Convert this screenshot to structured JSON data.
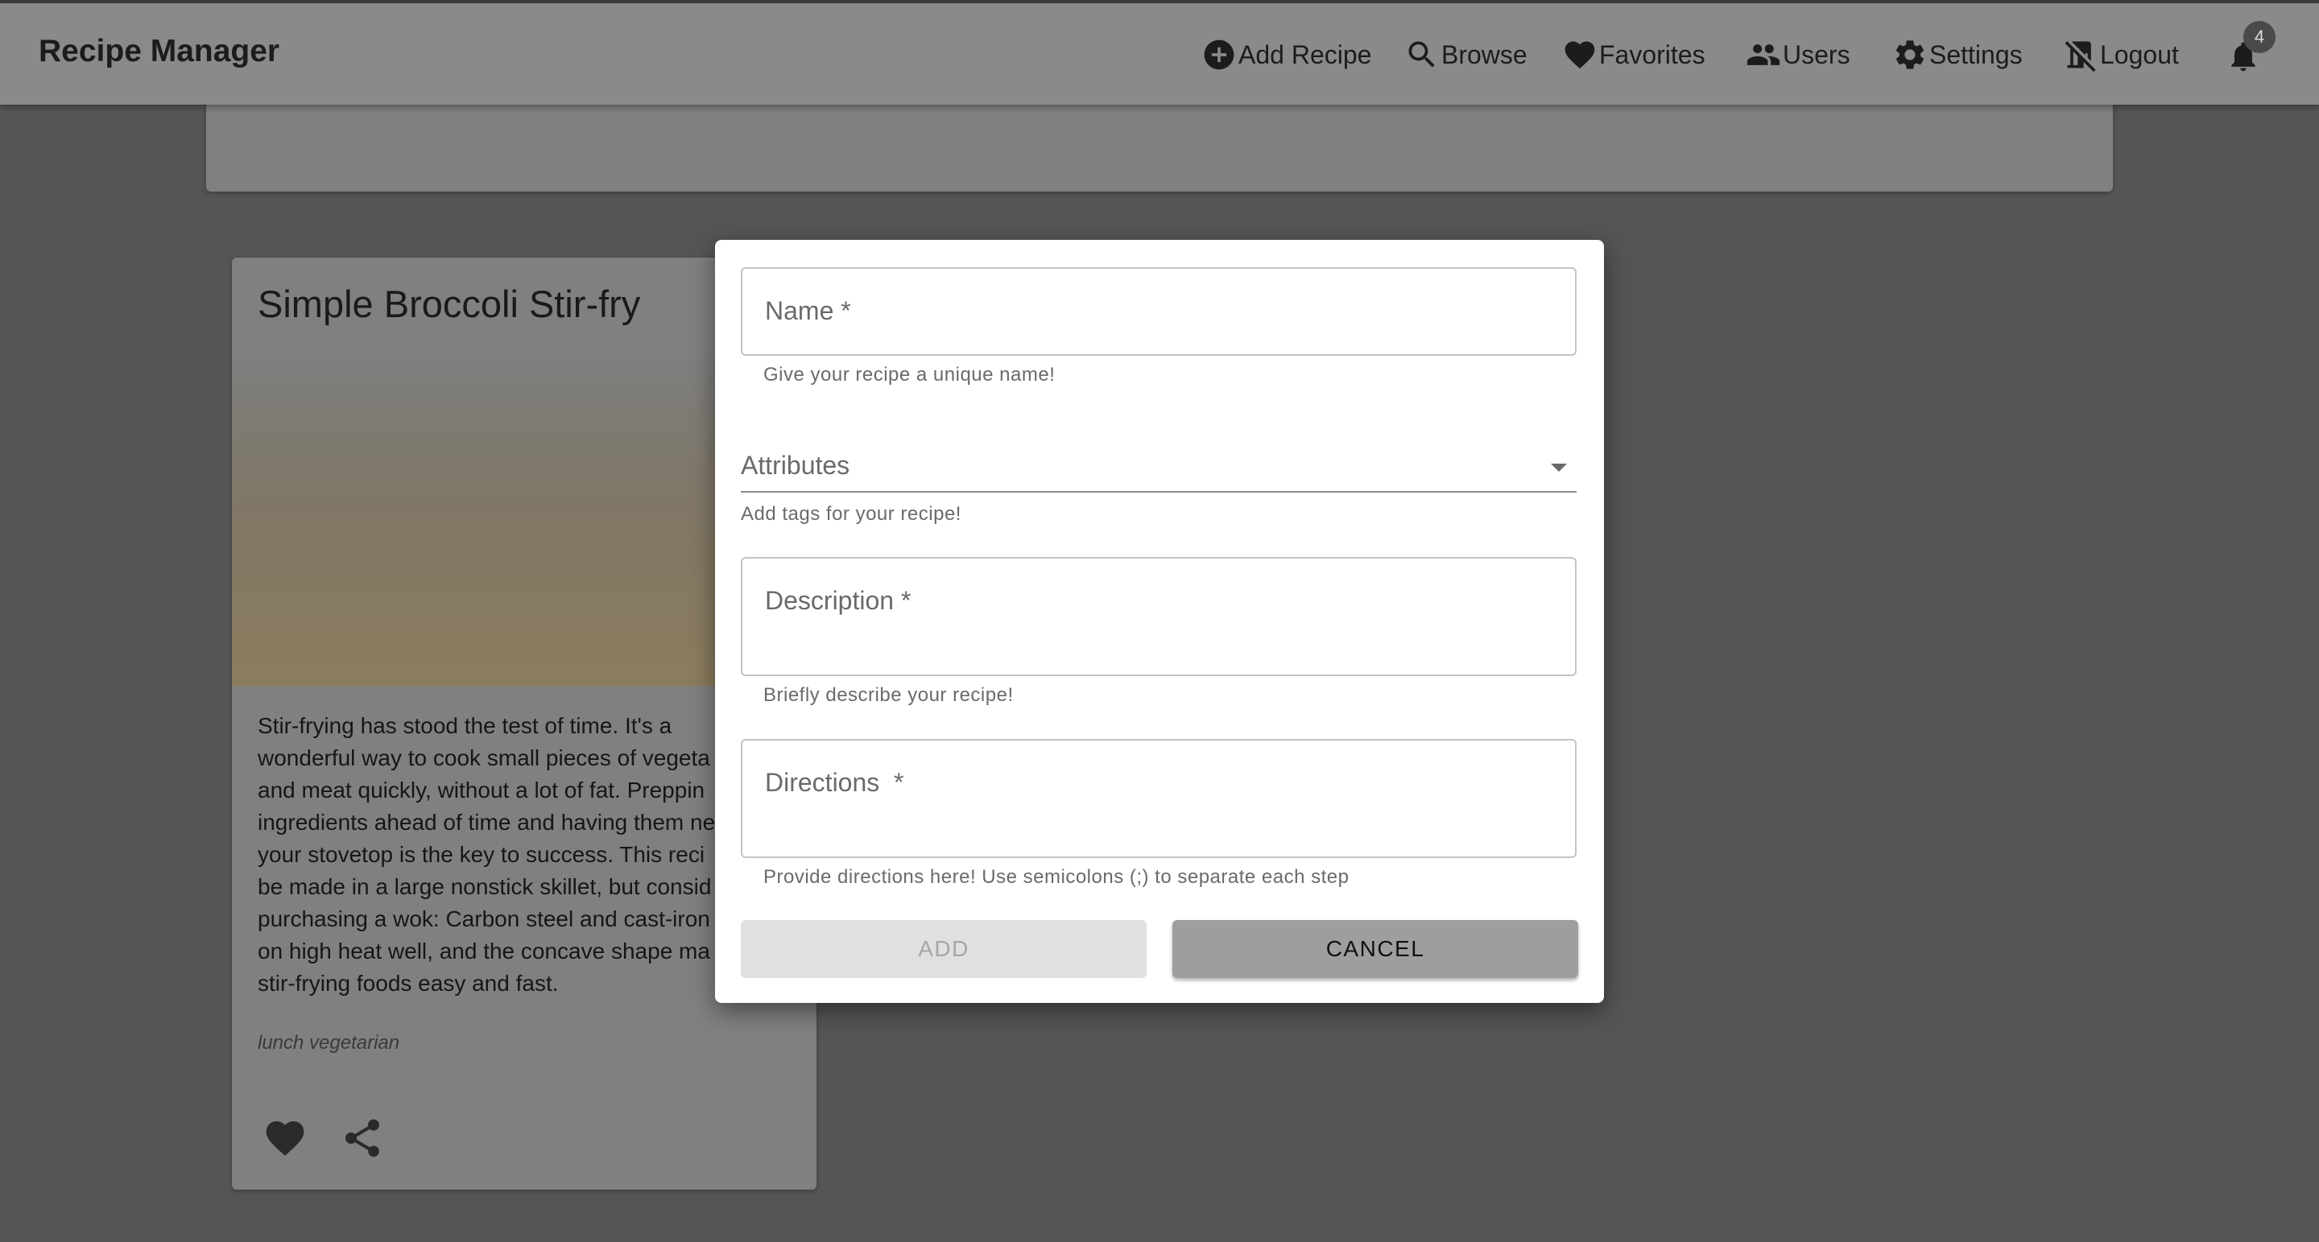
{
  "app": {
    "title": "Recipe Manager"
  },
  "nav": {
    "items": [
      {
        "label": "Add Recipe",
        "icon": "add-circle-icon"
      },
      {
        "label": "Browse",
        "icon": "search-icon"
      },
      {
        "label": "Favorites",
        "icon": "heart-icon"
      },
      {
        "label": "Users",
        "icon": "people-icon"
      },
      {
        "label": "Settings",
        "icon": "gear-icon"
      },
      {
        "label": "Logout",
        "icon": "no-door-icon"
      }
    ],
    "notifications": {
      "icon": "bell-icon",
      "count": "4"
    }
  },
  "recipe_card": {
    "title": "Simple Broccoli Stir-fry",
    "description_lines": [
      "Stir-frying has stood the test of time. It's a",
      "wonderful way to cook small pieces of vegeta",
      "and meat quickly, without a lot of fat. Preppin",
      "ingredients ahead of time and having them ne",
      "your stovetop is the key to success. This reci",
      "be made in a large nonstick skillet, but consid",
      "purchasing a wok: Carbon steel and cast-iron",
      "on high heat well, and the concave shape ma",
      "stir-frying foods easy and fast."
    ],
    "tags": "lunch vegetarian",
    "actions": [
      "heart-icon",
      "share-icon"
    ]
  },
  "dialog": {
    "name": {
      "label": "Name *",
      "helper": "Give your recipe a unique name!"
    },
    "attributes": {
      "label": "Attributes",
      "helper": "Add tags for your recipe!"
    },
    "description": {
      "label": "Description *",
      "helper": "Briefly describe your recipe!"
    },
    "directions": {
      "label": "Directions  *",
      "helper": "Provide directions here! Use semicolons (;) to separate each step"
    },
    "add_label": "ADD",
    "cancel_label": "CANCEL"
  }
}
